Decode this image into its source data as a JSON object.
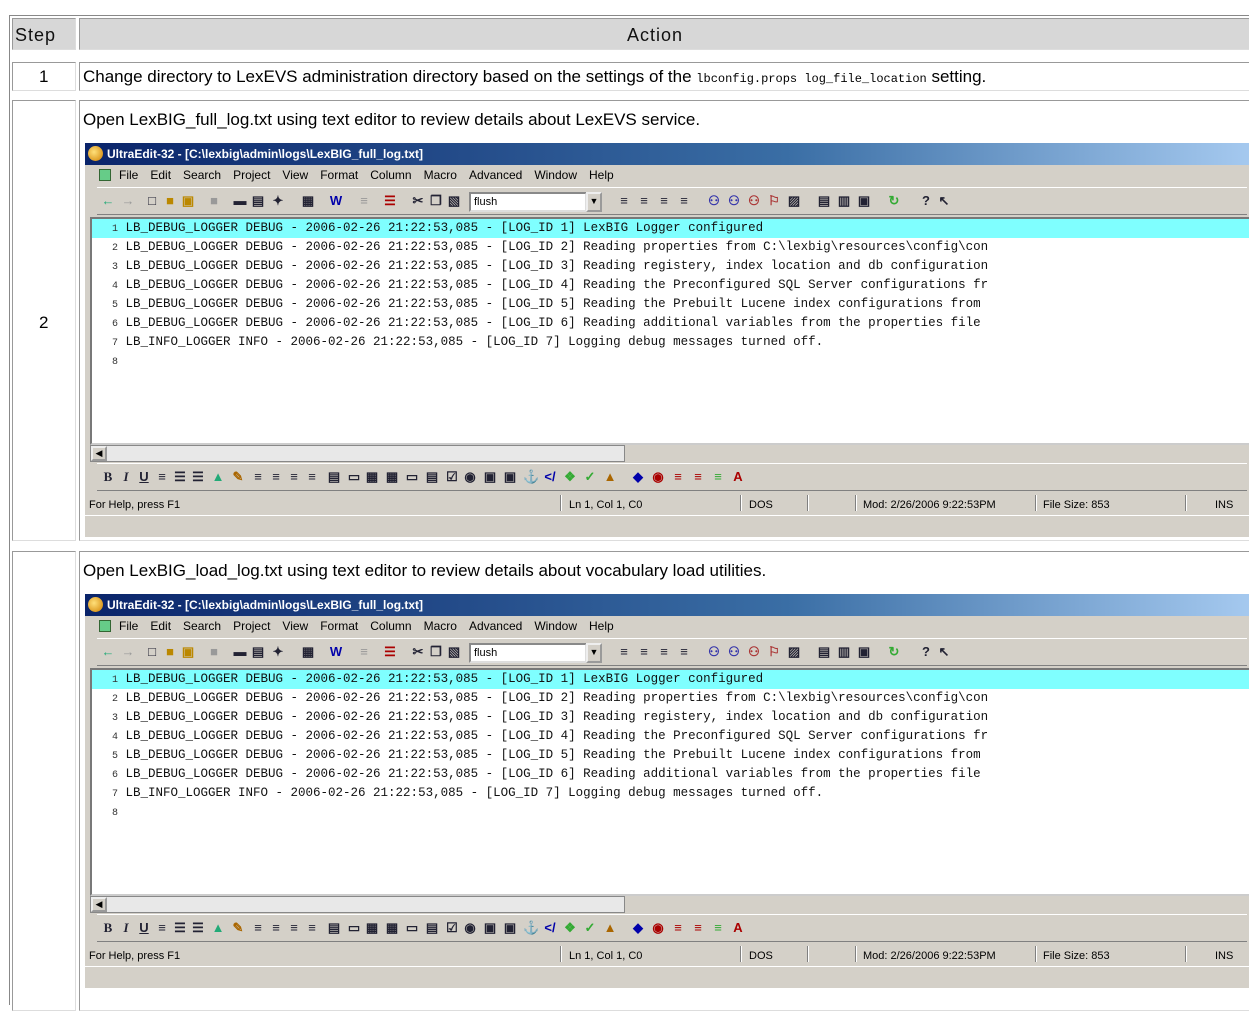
{
  "table": {
    "header_step": "Step",
    "header_action": "Action",
    "row1": {
      "step": "1",
      "text_before": "Change directory to LexEVS administration directory based on the settings of the ",
      "code": "lbconfig.props log_file_location",
      "text_after": " setting."
    },
    "row2": {
      "step": "2",
      "text": "Open LexBIG_full_log.txt using text editor to review details about LexEVS service."
    },
    "row3": {
      "step": "",
      "text": "Open LexBIG_load_log.txt using text editor to review details about vocabulary load utilities."
    }
  },
  "screenshot": {
    "title": "UltraEdit-32 - [C:\\lexbig\\admin\\logs\\LexBIG_full_log.txt]",
    "menus": [
      "File",
      "Edit",
      "Search",
      "Project",
      "View",
      "Format",
      "Column",
      "Macro",
      "Advanced",
      "Window",
      "Help"
    ],
    "font_combo": "flush",
    "lines": [
      {
        "num": "1",
        "text": "LB_DEBUG_LOGGER DEBUG - 2006-02-26 21:22:53,085 - [LOG_ID 1] LexBIG Logger configured"
      },
      {
        "num": "2",
        "text": "LB_DEBUG_LOGGER DEBUG - 2006-02-26 21:22:53,085 - [LOG_ID 2] Reading properties from C:\\lexbig\\resources\\config\\con"
      },
      {
        "num": "3",
        "text": "LB_DEBUG_LOGGER DEBUG - 2006-02-26 21:22:53,085 - [LOG_ID 3] Reading registery, index location and db configuration"
      },
      {
        "num": "4",
        "text": "LB_DEBUG_LOGGER DEBUG - 2006-02-26 21:22:53,085 - [LOG_ID 4] Reading the Preconfigured SQL Server configurations fr"
      },
      {
        "num": "5",
        "text": "LB_DEBUG_LOGGER DEBUG - 2006-02-26 21:22:53,085 - [LOG_ID 5] Reading the Prebuilt Lucene index configurations from"
      },
      {
        "num": "6",
        "text": "LB_DEBUG_LOGGER DEBUG - 2006-02-26 21:22:53,085 - [LOG_ID 6] Reading additional variables from the properties file"
      },
      {
        "num": "7",
        "text": "LB_INFO_LOGGER INFO - 2006-02-26 21:22:53,085 - [LOG_ID 7] Logging debug messages turned off."
      },
      {
        "num": "8",
        "text": ""
      }
    ],
    "status": {
      "help": "For Help, press F1",
      "position": "Ln 1, Col 1, C0",
      "format": "DOS",
      "modified": "Mod: 2/26/2006 9:22:53PM",
      "size": "File Size: 853",
      "mode": "INS"
    }
  },
  "colors": {
    "header_bg": "#d7d7d7",
    "titlebar_start": "#0a246a",
    "titlebar_end": "#a6caf0",
    "highlight_line": "#7fffff",
    "window_face": "#d4d0c8"
  }
}
